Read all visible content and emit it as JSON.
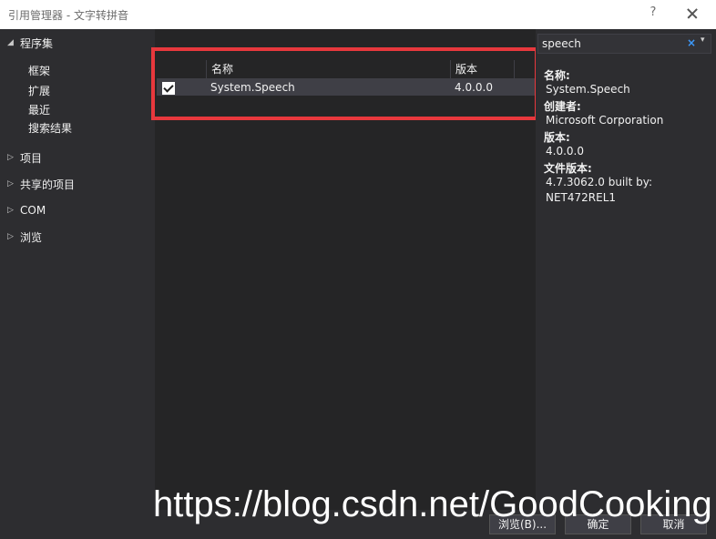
{
  "window": {
    "title": "引用管理器 - 文字转拼音",
    "help": "?"
  },
  "nav": {
    "assemblies": {
      "label": "程序集",
      "expanded": true,
      "items": [
        "框架",
        "扩展",
        "最近",
        "搜索结果"
      ]
    },
    "groups": [
      {
        "label": "项目"
      },
      {
        "label": "共享的项目"
      },
      {
        "label": "COM"
      },
      {
        "label": "浏览"
      }
    ]
  },
  "list": {
    "columns": [
      "名称",
      "版本"
    ],
    "rows": [
      {
        "checked": true,
        "name": "System.Speech",
        "version": "4.0.0.0"
      }
    ]
  },
  "search": {
    "value": "speech",
    "clear_icon": "×",
    "dropdown_icon": "▾"
  },
  "details": {
    "name_label": "名称:",
    "name_value": "System.Speech",
    "creator_label": "创建者:",
    "creator_value": "Microsoft Corporation",
    "version_label": "版本:",
    "version_value": "4.0.0.0",
    "file_version_label": "文件版本:",
    "file_version_value_1": "4.7.3062.0 built by:",
    "file_version_value_2": "NET472REL1"
  },
  "buttons": {
    "browse": "浏览(B)...",
    "ok": "确定",
    "cancel": "取消"
  },
  "watermark": "https://blog.csdn.net/GoodCooking",
  "colors": {
    "highlight": "#e8383d",
    "background": "#252526",
    "panel": "#2d2d30"
  }
}
